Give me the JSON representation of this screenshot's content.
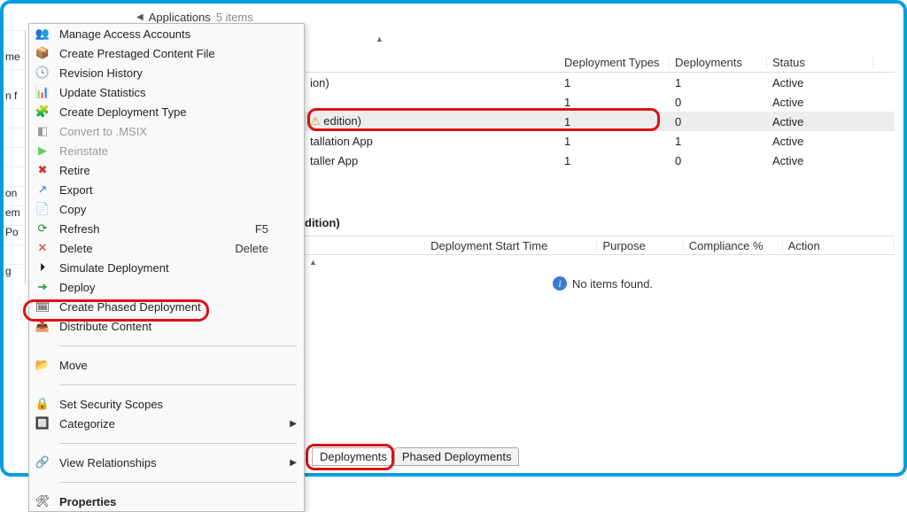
{
  "breadcrumb": {
    "title": "Applications",
    "count": "5 items"
  },
  "left_fragments": [
    "",
    "me",
    "",
    "n f",
    "",
    "",
    "",
    "",
    "on",
    "em",
    "Po",
    "",
    "g"
  ],
  "ctx": {
    "manage_access": "Manage Access Accounts",
    "prestaged": "Create Prestaged Content File",
    "revision": "Revision History",
    "update_stats": "Update Statistics",
    "create_dep_type": "Create Deployment Type",
    "convert_msix": "Convert to .MSIX",
    "reinstate": "Reinstate",
    "retire": "Retire",
    "export": "Export",
    "copy": "Copy",
    "refresh": "Refresh",
    "refresh_sc": "F5",
    "delete": "Delete",
    "delete_sc": "Delete",
    "simulate": "Simulate Deployment",
    "deploy": "Deploy",
    "phased": "Create Phased Deployment",
    "distribute": "Distribute Content",
    "move": "Move",
    "security": "Set Security Scopes",
    "categorize": "Categorize",
    "view_rel": "View Relationships",
    "properties": "Properties"
  },
  "grid": {
    "columns": {
      "name": "",
      "dep_types": "Deployment Types",
      "deployments": "Deployments",
      "status": "Status"
    },
    "rows": [
      {
        "name": "ion)",
        "dt": "1",
        "dp": "1",
        "status": "Active"
      },
      {
        "name": "",
        "dt": "1",
        "dp": "0",
        "status": "Active"
      },
      {
        "name": "edition)",
        "dt": "1",
        "dp": "0",
        "status": "Active"
      },
      {
        "name": "tallation App",
        "dt": "1",
        "dp": "1",
        "status": "Active"
      },
      {
        "name": "taller App",
        "dt": "1",
        "dp": "0",
        "status": "Active"
      }
    ]
  },
  "detail": {
    "title_fragment": "dition)",
    "columns": {
      "c1": "",
      "c2": "Deployment Start Time",
      "c3": "Purpose",
      "c4": "Compliance %",
      "c5": "Action"
    },
    "empty": "No items found."
  },
  "tabs": {
    "deployments": "Deployments",
    "phased": "Phased Deployments"
  }
}
